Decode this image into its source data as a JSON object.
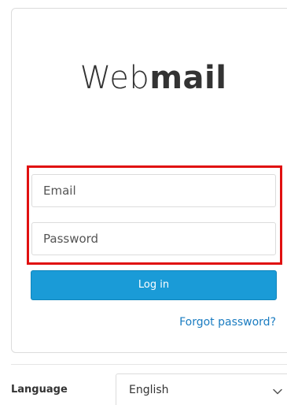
{
  "login": {
    "logo_light": "Web",
    "logo_bold": "mail",
    "email_placeholder": "Email",
    "password_placeholder": "Password",
    "login_button": "Log in",
    "forgot_password": "Forgot password?"
  },
  "footer": {
    "language_label": "Language",
    "language_value": "English"
  },
  "colors": {
    "primary_button": "#1a9bd7",
    "link": "#1a7cc1",
    "highlight": "#e01010"
  }
}
